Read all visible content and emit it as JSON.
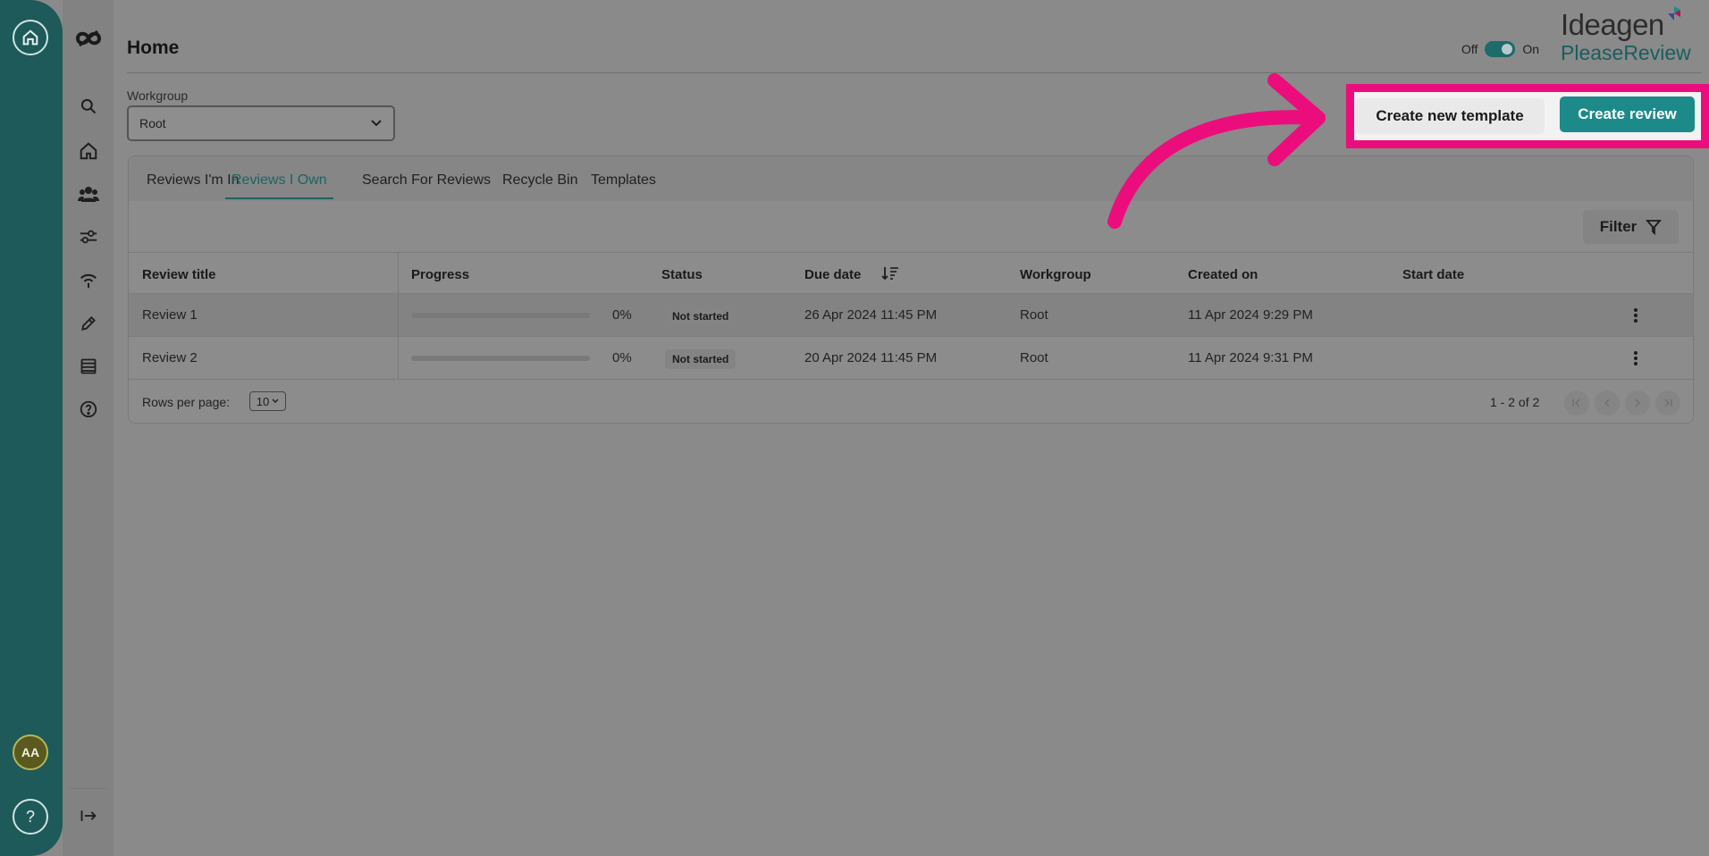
{
  "header": {
    "title": "Home",
    "toggle_off": "Off",
    "toggle_on": "On",
    "logo_top": "Ideagen",
    "logo_bottom": "PleaseReview"
  },
  "workgroup": {
    "label": "Workgroup",
    "value": "Root"
  },
  "actions": {
    "create_template": "Create new template",
    "create_review": "Create review"
  },
  "tabs": [
    {
      "label": "Reviews I'm In"
    },
    {
      "label": "Reviews I Own"
    },
    {
      "label": "Search For Reviews"
    },
    {
      "label": "Recycle Bin"
    },
    {
      "label": "Templates"
    }
  ],
  "filter_label": "Filter",
  "table": {
    "columns": [
      "Review title",
      "Progress",
      "Status",
      "Due date",
      "Workgroup",
      "Created on",
      "Start date"
    ],
    "rows": [
      {
        "title": "Review 1",
        "progress": "0%",
        "status": "Not started",
        "due": "26 Apr 2024 11:45 PM",
        "workgroup": "Root",
        "created": "11 Apr 2024 9:29 PM",
        "start": ""
      },
      {
        "title": "Review 2",
        "progress": "0%",
        "status": "Not started",
        "due": "20 Apr 2024 11:45 PM",
        "workgroup": "Root",
        "created": "11 Apr 2024 9:31 PM",
        "start": ""
      }
    ]
  },
  "footer": {
    "rows_per_page_label": "Rows per page:",
    "rows_per_page_value": "10",
    "range": "1 - 2 of 2"
  },
  "user": {
    "initials": "AA"
  },
  "help_glyph": "?",
  "colors": {
    "accent": "#1d8a8a",
    "rail": "#1d5a59",
    "highlight": "#ec0d7d"
  }
}
